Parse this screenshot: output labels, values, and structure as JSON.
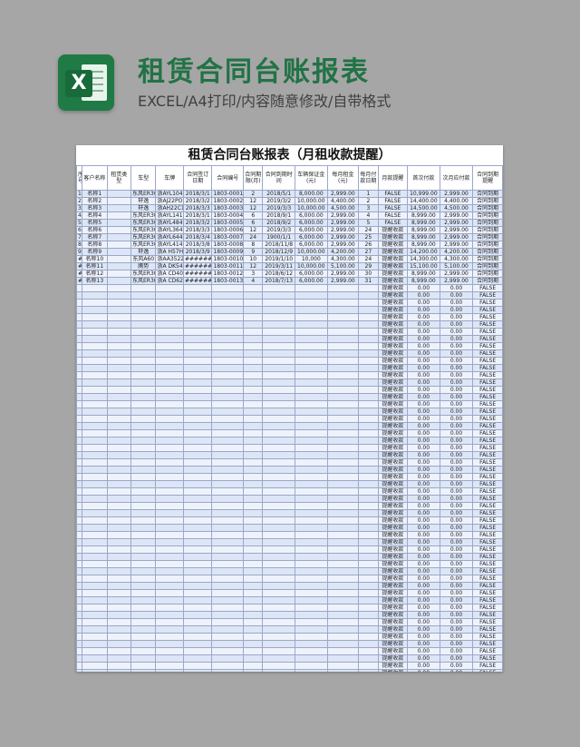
{
  "header": {
    "title": "租赁合同台账报表",
    "subtitle": "EXCEL/A4打印/内容随意修改/自带格式",
    "logo_letter": "X"
  },
  "sheet": {
    "title": "租赁合同台账报表（月租收款提醒）",
    "columns": [
      "序号",
      "客户名称",
      "租赁类型",
      "车型",
      "车牌",
      "合同签订日期",
      "合同编号",
      "合同期限(月)",
      "合同到期时间",
      "车辆保证金(元)",
      "每月租金(元)",
      "每月付款日期",
      "月款提醒",
      "首次付款",
      "次月应付款",
      "合同到期提醒"
    ],
    "rows": [
      [
        "1",
        "名称1",
        "",
        "东风ER30",
        "浙AYL104",
        "2018/3/1",
        "1803-0001",
        "2",
        "2018/5/1",
        "8,000.00",
        "2,999.00",
        "1",
        "FALSE",
        "10,999.00",
        "2,999.00",
        "合同到期"
      ],
      [
        "2",
        "名称2",
        "",
        "轩逸",
        "浙AJ22PO",
        "2018/3/2",
        "1803-0002",
        "12",
        "2019/3/2",
        "10,000.00",
        "4,400.00",
        "2",
        "FALSE",
        "14,400.00",
        "4,400.00",
        "合同到期"
      ],
      [
        "3",
        "名称3",
        "",
        "轩逸",
        "浙AH22C1",
        "2018/3/3",
        "1803-0003",
        "12",
        "2019/3/3",
        "10,000.00",
        "4,500.00",
        "3",
        "FALSE",
        "14,500.00",
        "4,500.00",
        "合同到期"
      ],
      [
        "4",
        "名称4",
        "",
        "东风ER30",
        "浙AYL141",
        "2018/3/1",
        "1803-0004",
        "6",
        "2018/9/1",
        "6,000.00",
        "2,999.00",
        "4",
        "FALSE",
        "8,999.00",
        "2,999.00",
        "合同到期"
      ],
      [
        "5",
        "名称5",
        "",
        "东风ER30",
        "浙AYL484",
        "2018/3/2",
        "1803-0005",
        "6",
        "2018/9/2",
        "6,000.00",
        "2,999.00",
        "5",
        "FALSE",
        "8,999.00",
        "2,999.00",
        "合同到期"
      ],
      [
        "6",
        "名称6",
        "",
        "东风ER30",
        "浙AYL364",
        "2018/3/3",
        "1803-0006",
        "12",
        "2019/3/3",
        "6,000.00",
        "2,999.00",
        "24",
        "提醒收款",
        "8,999.00",
        "2,999.00",
        "合同到期"
      ],
      [
        "7",
        "名称7",
        "",
        "东风ER30",
        "浙AYL644",
        "2018/3/4",
        "1803-0007",
        "24",
        "1900/1/1",
        "6,000.00",
        "2,999.00",
        "25",
        "提醒收款",
        "8,999.00",
        "2,999.00",
        "合同到期"
      ],
      [
        "8",
        "名称8",
        "",
        "东风ER30",
        "浙AYL414",
        "2018/3/8",
        "1803-0008",
        "8",
        "2018/11/8",
        "6,000.00",
        "2,999.00",
        "26",
        "提醒收款",
        "8,999.00",
        "2,999.00",
        "合同到期"
      ],
      [
        "9",
        "名称9",
        "",
        "轩逸",
        "浙A H57HC",
        "2018/3/9",
        "1803-0009",
        "9",
        "2018/12/9",
        "10,000.00",
        "4,200.00",
        "27",
        "提醒收款",
        "14,200.00",
        "4,200.00",
        "合同到期"
      ],
      [
        "#",
        "名称10",
        "",
        "东风A60",
        "浙AA3522",
        "#######",
        "1803-0010",
        "10",
        "2019/1/10",
        "10,000",
        "4,300.00",
        "24",
        "提醒收款",
        "14,300.00",
        "4,300.00",
        "合同到期"
      ],
      [
        "#",
        "名称11",
        "",
        "腾势",
        "浙A DK545",
        "#######",
        "1803-0011",
        "12",
        "2019/3/11",
        "10,000.00",
        "5,100.00",
        "29",
        "提醒收款",
        "15,100.00",
        "5,100.00",
        "合同到期"
      ],
      [
        "#",
        "名称12",
        "",
        "东风ER30",
        "浙A CD407",
        "#######",
        "1803-0012",
        "3",
        "2018/6/12",
        "6,000.00",
        "2,999.00",
        "30",
        "提醒收款",
        "8,999.00",
        "2,999.00",
        "合同到期"
      ],
      [
        "#",
        "名称13",
        "",
        "东风ER30",
        "浙A CD624",
        "#######",
        "1803-0013",
        "4",
        "2018/7/13",
        "6,000.00",
        "2,999.00",
        "31",
        "提醒收款",
        "8,999.00",
        "2,999.00",
        "合同到期"
      ]
    ],
    "blank_row": [
      "",
      "",
      "",
      "",
      "",
      "",
      "",
      "",
      "",
      "",
      "",
      "",
      "提醒收款",
      "0.00",
      "0.00",
      "FALSE"
    ],
    "blank_row_count": 65
  }
}
